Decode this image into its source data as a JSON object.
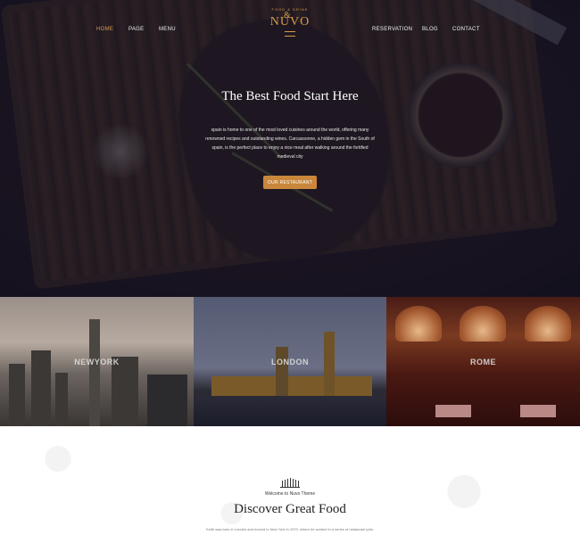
{
  "nav": {
    "left": [
      "HOME",
      "PAGE",
      "MENU"
    ],
    "right": [
      "RESERVATION",
      "BLOG",
      "CONTACT"
    ]
  },
  "logo": {
    "tagline": "FOOD & DRINK",
    "name": "NUVO"
  },
  "hero": {
    "title": "The Best Food Start Here",
    "text": "spain is home to one of the most loved cuisines around the world, offering many renowned recipes and outstanding wines. Carcassonne, a hidden gem in the South of spain, is the perfect place to enjoy a nice meal after walking around the fortified medieval city",
    "button": "OUR RESTAURANT"
  },
  "cities": [
    "NEWYORK",
    "LONDON",
    "ROME"
  ],
  "section": {
    "subtitle": "Welcome to Nuvo Theme",
    "title": "Discover Great Food",
    "intro": "Keith was born in London and moved to New York in 1979, where he worked in a series of restaurant jobs."
  },
  "colors": {
    "accent": "#c9873c",
    "nav_active": "#d89a4a"
  }
}
